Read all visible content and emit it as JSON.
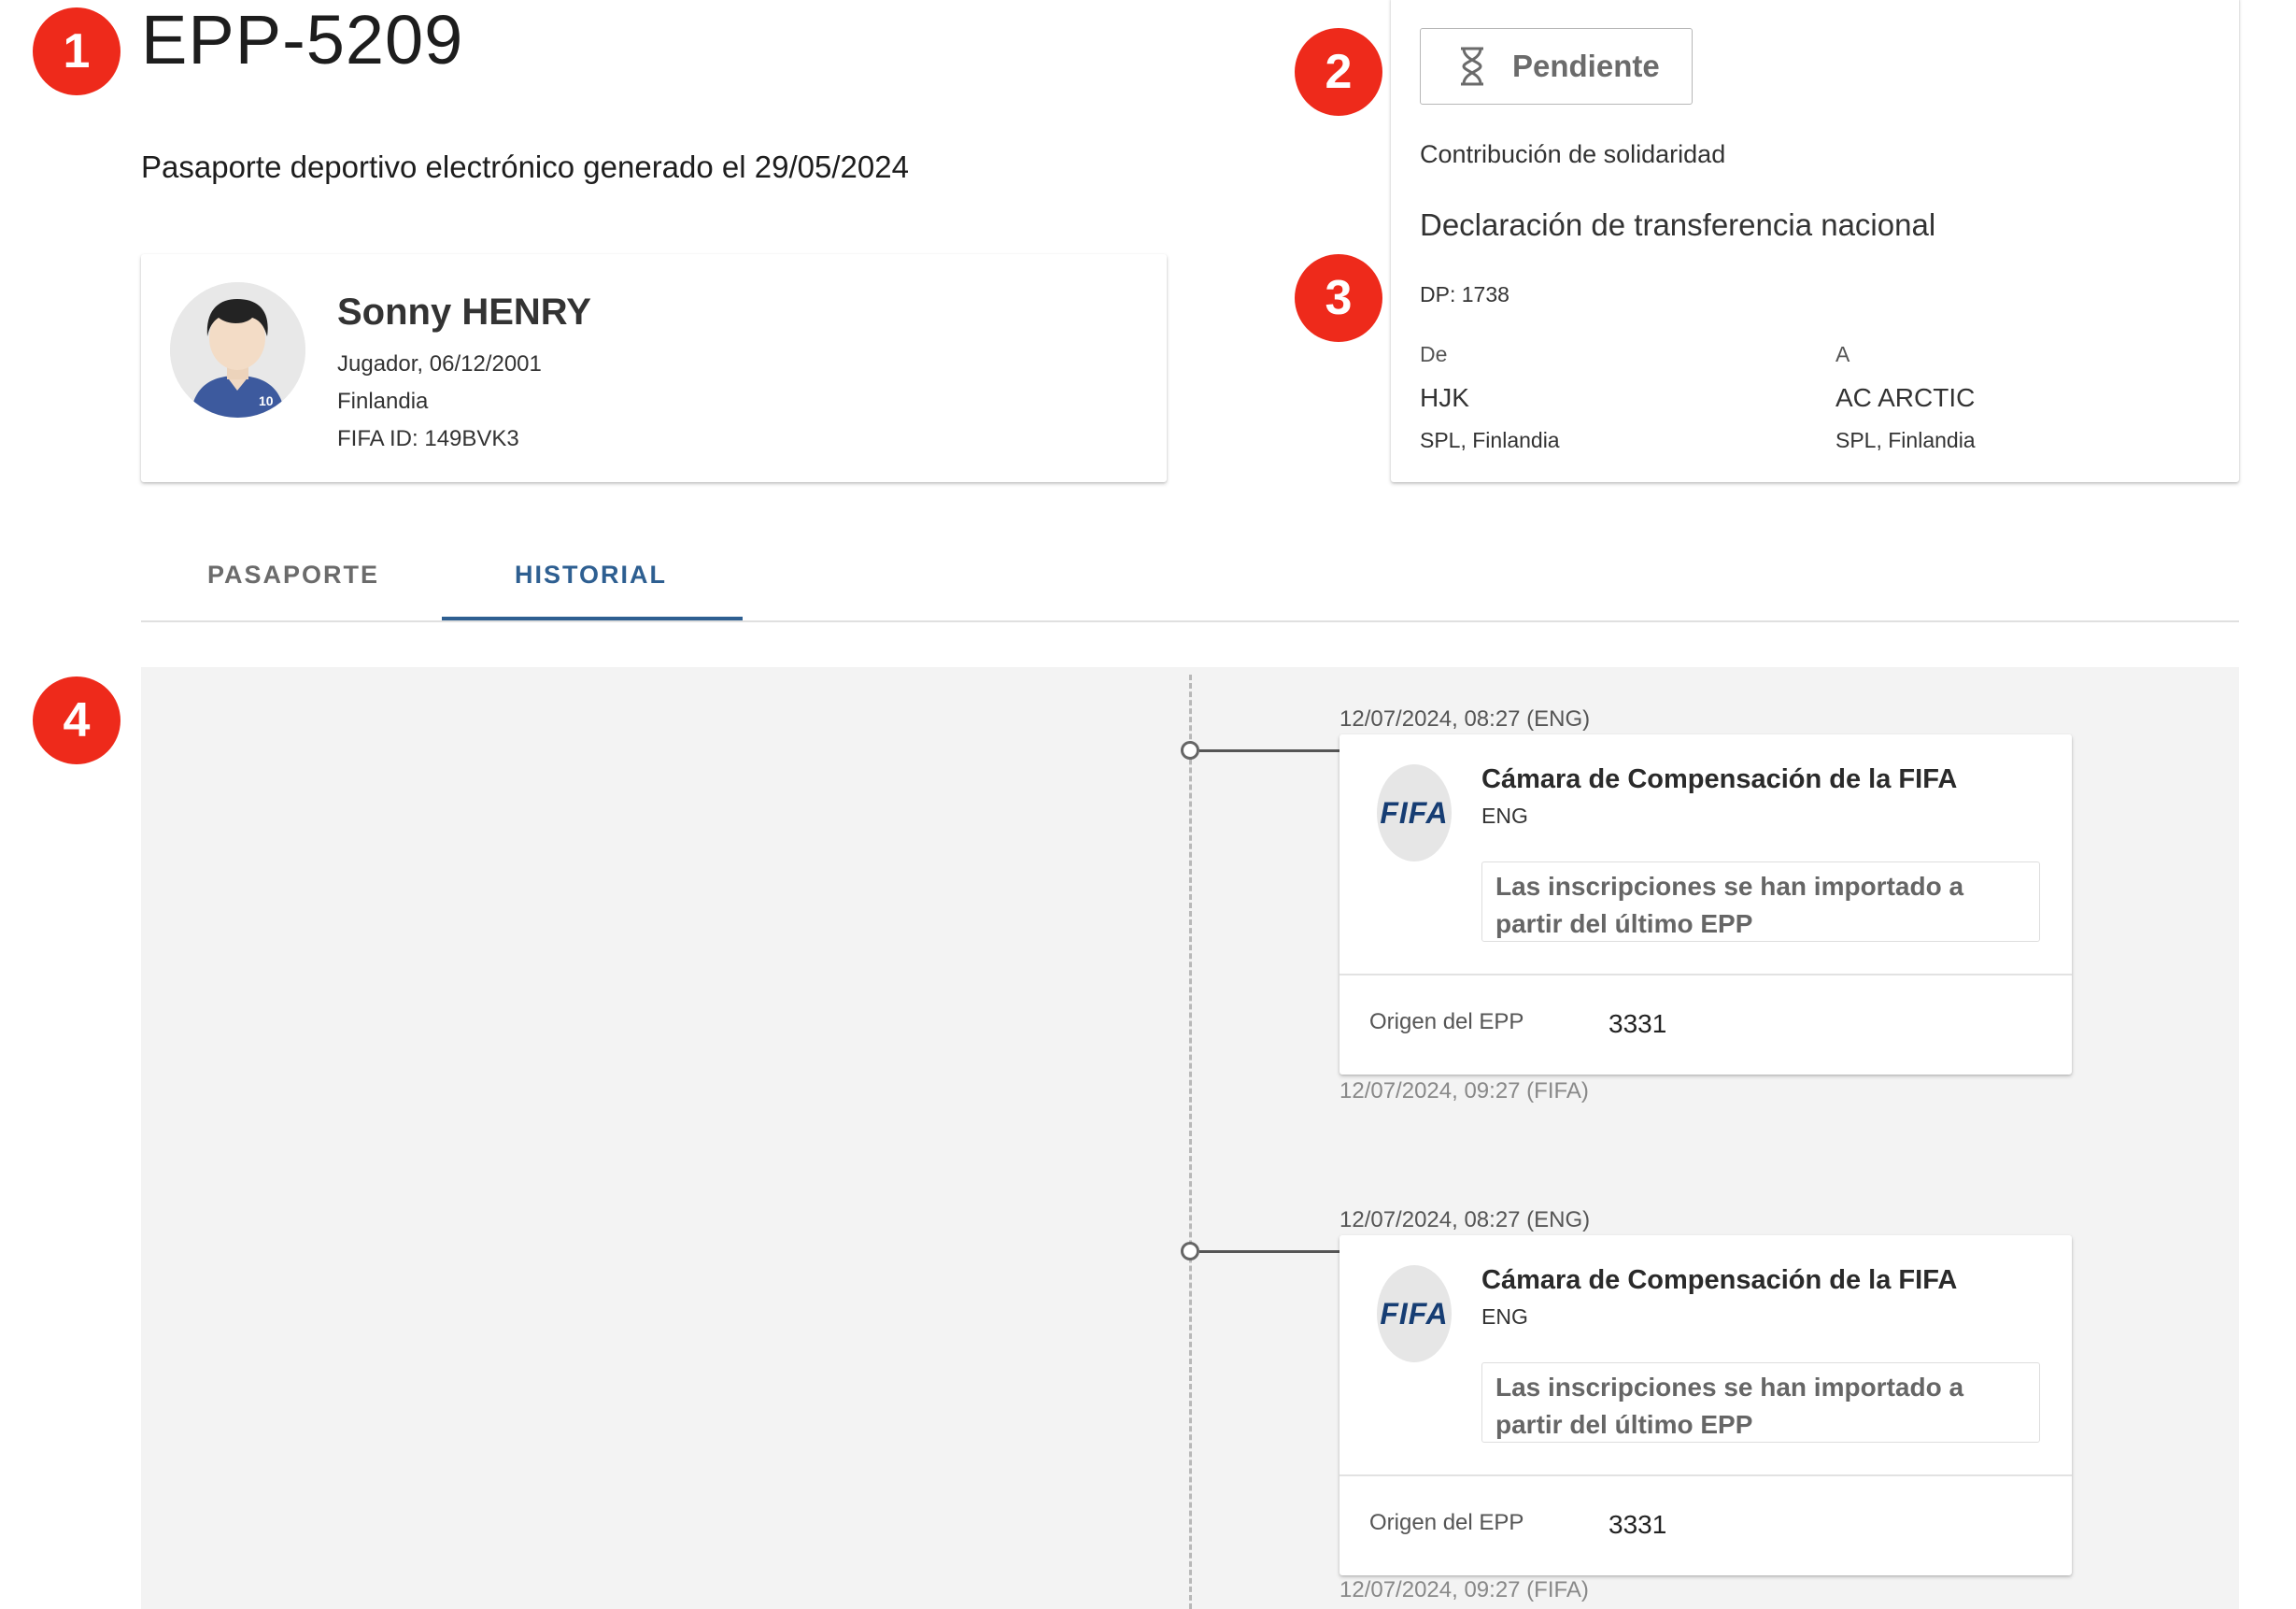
{
  "header": {
    "epp_id": "EPP-5209",
    "subtitle": "Pasaporte deportivo electrónico generado el 29/05/2024"
  },
  "callouts": [
    "1",
    "2",
    "3",
    "4"
  ],
  "player": {
    "name": "Sonny HENRY",
    "role_birth": "Jugador, 06/12/2001",
    "country": "Finlandia",
    "fifa_id": "FIFA ID: 149BVK3",
    "shirt_number": "10"
  },
  "status": {
    "label": "Pendiente",
    "icon": "hourglass-icon",
    "contribution": "Contribución de solidaridad",
    "declaration": "Declaración de transferencia nacional",
    "dp": "DP: 1738",
    "from_label": "De",
    "from_club": "HJK",
    "from_league": "SPL, Finlandia",
    "to_label": "A",
    "to_club": "AC ARCTIC",
    "to_league": "SPL, Finlandia"
  },
  "tabs": [
    {
      "label": "PASAPORTE",
      "active": false
    },
    {
      "label": "HISTORIAL",
      "active": true
    }
  ],
  "history": [
    {
      "timestamp_top": "12/07/2024, 08:27 (ENG)",
      "org": "Cámara de Compensación de la FIFA",
      "org_code": "ENG",
      "logo_text": "FIFA",
      "note": "Las inscripciones se han importado a partir del último EPP",
      "origin_label": "Origen del EPP",
      "origin_value": "3331",
      "timestamp_bottom": "12/07/2024, 09:27 (FIFA)"
    },
    {
      "timestamp_top": "12/07/2024, 08:27 (ENG)",
      "org": "Cámara de Compensación de la FIFA",
      "org_code": "ENG",
      "logo_text": "FIFA",
      "note": "Las inscripciones se han importado a partir del último EPP",
      "origin_label": "Origen del EPP",
      "origin_value": "3331",
      "timestamp_bottom": "12/07/2024, 09:27 (FIFA)"
    }
  ],
  "colors": {
    "callout": "#ee2a1b",
    "tab_active": "#2e5f91",
    "fifa_blue": "#163d73"
  }
}
